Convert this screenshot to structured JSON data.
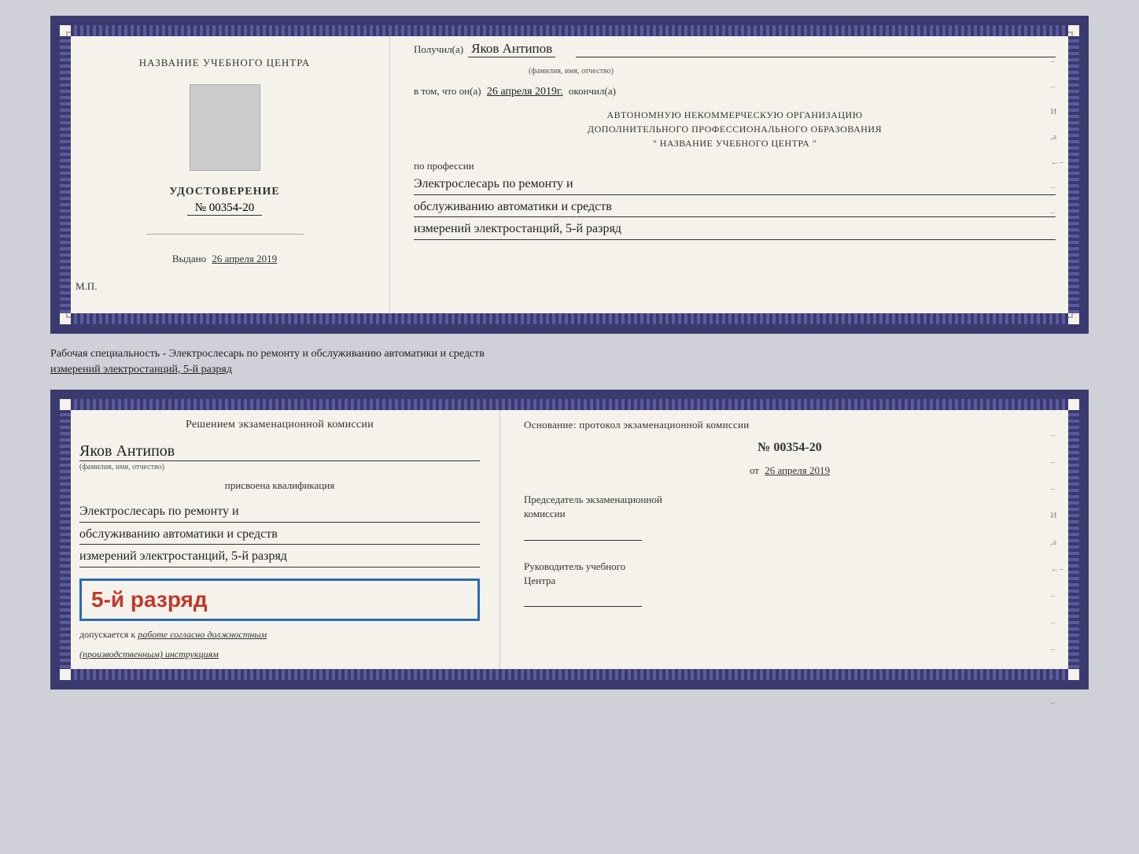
{
  "top_doc": {
    "left": {
      "title": "НАЗВАНИЕ УЧЕБНОГО ЦЕНТРА",
      "udost_label": "УДОСТОВЕРЕНИЕ",
      "number": "№ 00354-20",
      "issued_label": "Выдано",
      "issued_date": "26 апреля 2019",
      "mp_label": "М.П."
    },
    "right": {
      "recipient_prefix": "Получил(а)",
      "recipient_name": "Яков Антипов",
      "recipient_hint": "(фамилия, имя, отчество)",
      "date_prefix": "в том, что он(а)",
      "date_value": "26 апреля 2019г.",
      "date_suffix": "окончил(а)",
      "org_line1": "АВТОНОМНУЮ НЕКОММЕРЧЕСКУЮ ОРГАНИЗАЦИЮ",
      "org_line2": "ДОПОЛНИТЕЛЬНОГО ПРОФЕССИОНАЛЬНОГО ОБРАЗОВАНИЯ",
      "org_line3": "\"    НАЗВАНИЕ УЧЕБНОГО ЦЕНТРА    \"",
      "profession_label": "по профессии",
      "profession_line1": "Электрослесарь по ремонту и",
      "profession_line2": "обслуживанию автоматики и средств",
      "profession_line3": "измерений электростанций, 5-й разряд"
    }
  },
  "middle": {
    "text_line1": "Рабочая специальность - Электрослесарь по ремонту и обслуживанию автоматики и средств",
    "text_line2": "измерений электростанций, 5-й разряд"
  },
  "bottom_doc": {
    "left": {
      "komissia_title": "Решением экзаменационной комиссии",
      "person_name": "Яков Антипов",
      "person_hint": "(фамилия, имя, отчество)",
      "prisvoena_label": "присвоена квалификация",
      "qual_line1": "Электрослесарь по ремонту и",
      "qual_line2": "обслуживанию автоматики и средств",
      "qual_line3": "измерений электростанций, 5-й разряд",
      "rank_text": "5-й разряд",
      "dopusk_label": "допускается к",
      "dopusk_italic": "работе согласно должностным",
      "dopusk_italic2": "(производственным) инструкциям"
    },
    "right": {
      "osnov_label": "Основание: протокол экзаменационной комиссии",
      "protocol_num": "№ 00354-20",
      "ot_prefix": "от",
      "ot_date": "26 апреля 2019",
      "chairman_label": "Председатель экзаменационной",
      "chairman_label2": "комиссии",
      "director_label": "Руководитель учебного",
      "director_label2": "Центра"
    },
    "side_marks": [
      "И",
      "а",
      "←",
      "–",
      "–",
      "–",
      "–",
      "–"
    ]
  }
}
